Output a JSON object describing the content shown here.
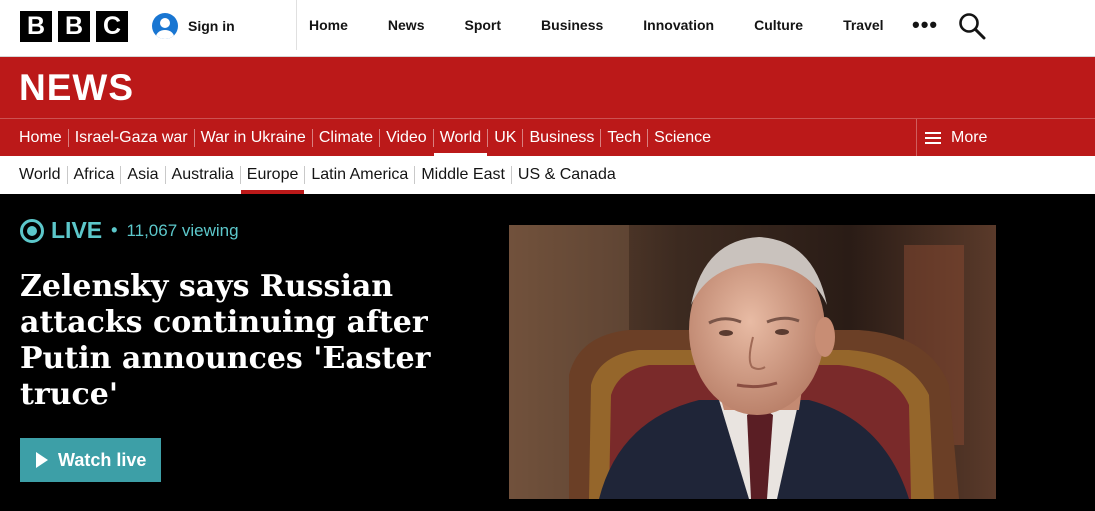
{
  "header": {
    "logo_letters": [
      "B",
      "B",
      "C"
    ],
    "signin_label": "Sign in",
    "nav": [
      "Home",
      "News",
      "Sport",
      "Business",
      "Innovation",
      "Culture",
      "Travel"
    ],
    "more_label": "•••",
    "icons": {
      "account": "user-icon",
      "search": "search-icon",
      "more": "more-dots-icon"
    }
  },
  "masthead": {
    "title": "NEWS",
    "brand_color": "#bb1919"
  },
  "section_nav": {
    "items": [
      "Home",
      "Israel-Gaza war",
      "War in Ukraine",
      "Climate",
      "Video",
      "World",
      "UK",
      "Business",
      "Tech",
      "Science"
    ],
    "active": "World",
    "more_label": "More"
  },
  "sub_nav": {
    "items": [
      "World",
      "Africa",
      "Asia",
      "Australia",
      "Europe",
      "Latin America",
      "Middle East",
      "US & Canada"
    ],
    "active": "Europe"
  },
  "hero": {
    "live_label": "LIVE",
    "separator": "•",
    "viewing": "11,067 viewing",
    "headline": "Zelensky says Russian attacks continuing after Putin announces 'Easter truce'",
    "cta_label": "Watch live",
    "accent_color": "#5cc7ca"
  }
}
